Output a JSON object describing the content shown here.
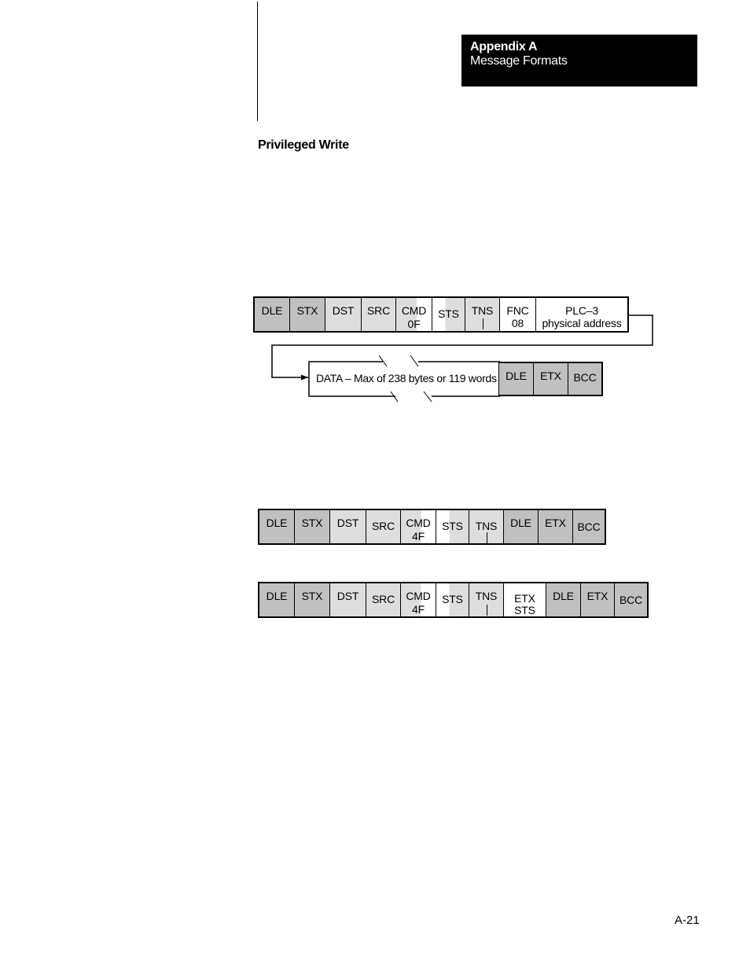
{
  "header": {
    "appendix": "Appendix A",
    "section": "Message Formats"
  },
  "section_title": "Privileged Write",
  "page_number": "A-21",
  "command_frame": {
    "cells": [
      {
        "label": "DLE"
      },
      {
        "label": "STX"
      },
      {
        "label": "DST"
      },
      {
        "label": "SRC"
      },
      {
        "label": "CMD",
        "sub": "0F"
      },
      {
        "label": "STS"
      },
      {
        "label": "TNS"
      },
      {
        "label": "FNC",
        "sub": "08"
      },
      {
        "label": "PLC–3",
        "sub": "physical address"
      }
    ],
    "data_label": "DATA – Max of 238 bytes or 119 words",
    "trailer": [
      {
        "label": "DLE"
      },
      {
        "label": "ETX"
      },
      {
        "label": "BCC"
      }
    ]
  },
  "reply_frame": {
    "cells": [
      {
        "label": "DLE"
      },
      {
        "label": "STX"
      },
      {
        "label": "DST"
      },
      {
        "label": "SRC"
      },
      {
        "label": "CMD",
        "sub": "4F"
      },
      {
        "label": "STS"
      },
      {
        "label": "TNS"
      },
      {
        "label": "DLE"
      },
      {
        "label": "ETX"
      },
      {
        "label": "BCC"
      }
    ]
  },
  "reply_frame_ext": {
    "cells": [
      {
        "label": "DLE"
      },
      {
        "label": "STX"
      },
      {
        "label": "DST"
      },
      {
        "label": "SRC"
      },
      {
        "label": "CMD",
        "sub": "4F"
      },
      {
        "label": "STS"
      },
      {
        "label": "TNS"
      },
      {
        "label": "ETX",
        "sub": "STS"
      },
      {
        "label": "DLE"
      },
      {
        "label": "ETX"
      },
      {
        "label": "BCC"
      }
    ]
  }
}
